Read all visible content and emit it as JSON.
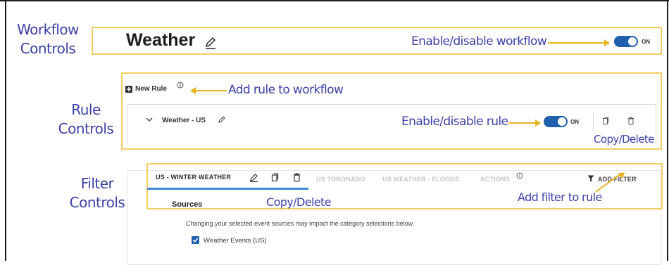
{
  "annotations": {
    "workflow_controls": [
      "Workflow",
      "Controls"
    ],
    "rule_controls": [
      "Rule",
      "Controls"
    ],
    "filter_controls": [
      "Filter",
      "Controls"
    ],
    "enable_disable_workflow": "Enable/disable workflow",
    "add_rule_to_workflow": "Add rule to workflow",
    "enable_disable_rule": "Enable/disable rule",
    "copy_delete_rule": "Copy/Delete",
    "copy_delete_filter": "Copy/Delete",
    "add_filter_to_rule": "Add filter to rule"
  },
  "workflow": {
    "title": "Weather",
    "toggle_state": "ON"
  },
  "rules": {
    "new_rule_label": "New Rule",
    "rule_name": "Weather - US",
    "toggle_state": "ON"
  },
  "filters": {
    "tabs": [
      {
        "label": "US - WINTER WEATHER",
        "active": true
      },
      {
        "label": "US TORONADO",
        "active": false
      },
      {
        "label": "US WEATHER - FLOODS",
        "active": false
      },
      {
        "label": "ACTIONS",
        "active": false
      }
    ],
    "add_filter_label": "ADD FILTER",
    "sources_heading": "Sources",
    "sources_note": "Changing your selected event sources may impact the category selections below.",
    "checkbox_label": "Weather Events (US)",
    "checkbox_checked": true
  },
  "colors": {
    "annotation_text": "#3d3fa8",
    "highlight_box": "#f2cd62",
    "arrow": "#e8b31e",
    "toggle_on": "#1f5fae",
    "tab_underline": "#3b86d6"
  }
}
